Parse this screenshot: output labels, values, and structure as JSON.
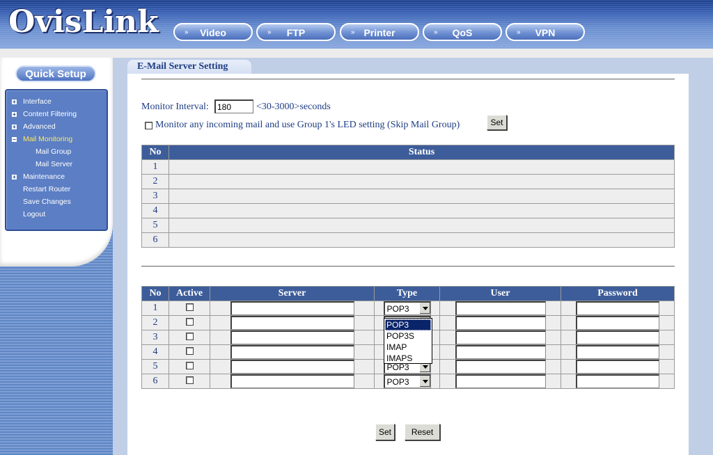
{
  "brand": {
    "logo": "OvisLink"
  },
  "topnav": [
    {
      "label": "Video"
    },
    {
      "label": "FTP"
    },
    {
      "label": "Printer"
    },
    {
      "label": "QoS"
    },
    {
      "label": "VPN"
    }
  ],
  "sidebar": {
    "quick_setup": "Quick Setup",
    "items": [
      {
        "label": "Interface",
        "expander": "+"
      },
      {
        "label": "Content Filtering",
        "expander": "+"
      },
      {
        "label": "Advanced",
        "expander": "+"
      },
      {
        "label": "Mail Monitoring",
        "expander": "−",
        "active": true
      },
      {
        "label": "Mail Group",
        "sub": true
      },
      {
        "label": "Mail Server",
        "sub": true
      },
      {
        "label": "Maintenance",
        "expander": "+"
      },
      {
        "label": "Restart Router"
      },
      {
        "label": "Save Changes"
      },
      {
        "label": "Logout"
      }
    ]
  },
  "page": {
    "tab_title": "E-Mail Server Setting",
    "monitor_label": "Monitor Interval:",
    "monitor_value": "180",
    "monitor_range": "<30-3000>seconds",
    "led_label": "Monitor any incoming mail and use Group 1's LED setting (Skip Mail Group)",
    "set_label": "Set",
    "status_table": {
      "headers": [
        "No",
        "Status"
      ],
      "rows": [
        "1",
        "2",
        "3",
        "4",
        "5",
        "6"
      ]
    },
    "server_table": {
      "headers": [
        "No",
        "Active",
        "Server",
        "Type",
        "User",
        "Password"
      ],
      "rows": [
        {
          "no": "1",
          "type": "POP3"
        },
        {
          "no": "2",
          "type": "POP3"
        },
        {
          "no": "3",
          "type": "POP3"
        },
        {
          "no": "4",
          "type": "POP3"
        },
        {
          "no": "5",
          "type": "POP3"
        },
        {
          "no": "6",
          "type": "POP3"
        }
      ]
    },
    "type_options": [
      "POP3",
      "POP3S",
      "IMAP",
      "IMAPS"
    ],
    "open_dropdown_selected": "POP3",
    "bottom_set": "Set",
    "bottom_reset": "Reset"
  },
  "colors": {
    "header_blue": "#3b62b5",
    "table_header": "#3d5d9a",
    "text_blue": "#1e3d82",
    "active_menu": "#ffe95a"
  }
}
